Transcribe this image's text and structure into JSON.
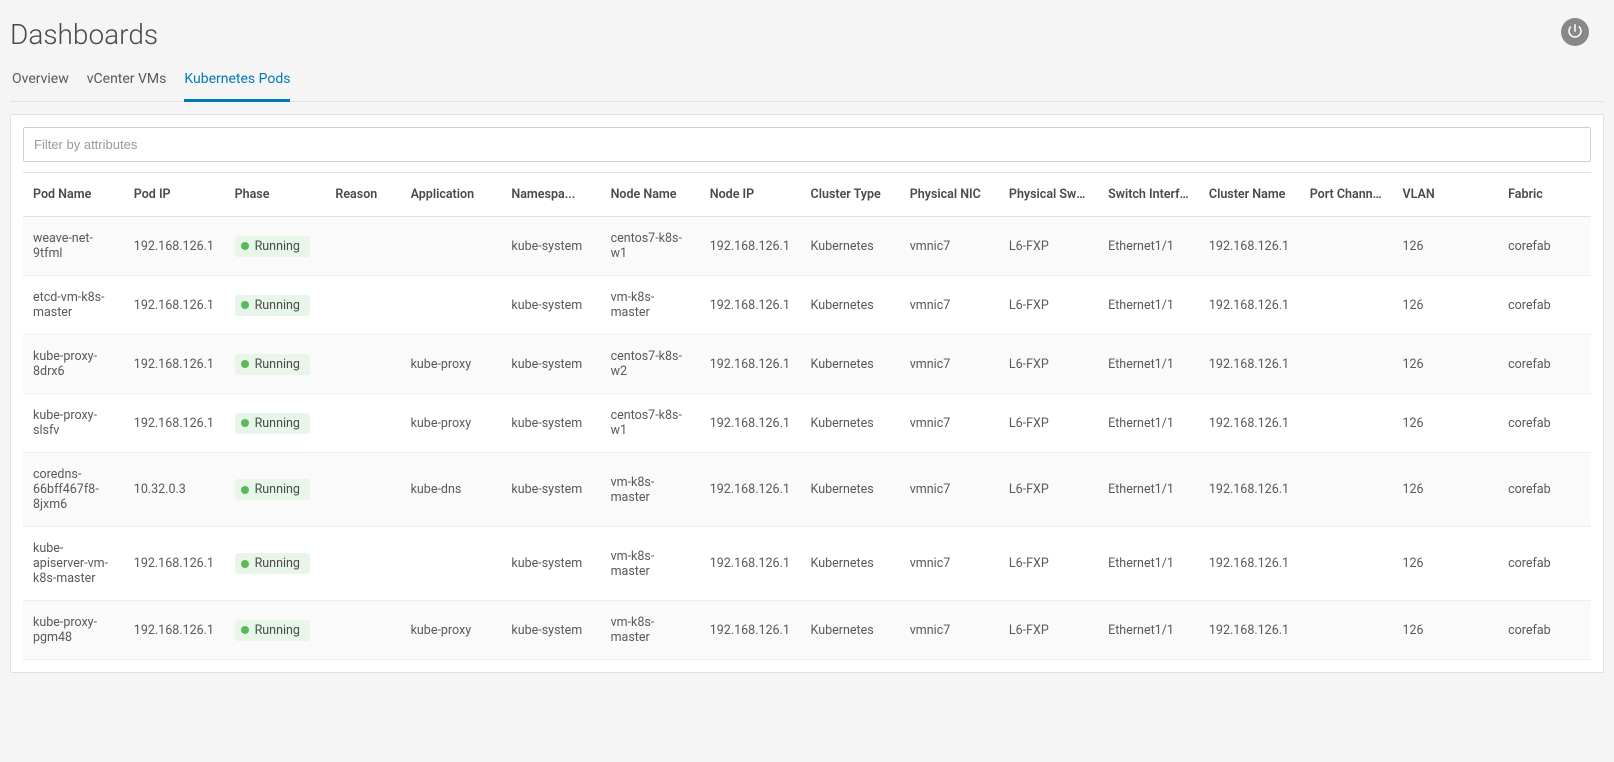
{
  "page_title": "Dashboards",
  "tabs": [
    {
      "label": "Overview",
      "active": false
    },
    {
      "label": "vCenter VMs",
      "active": false
    },
    {
      "label": "Kubernetes Pods",
      "active": true
    }
  ],
  "filter_placeholder": "Filter by attributes",
  "columns": [
    "Pod Name",
    "Pod IP",
    "Phase",
    "Reason",
    "Application",
    "Namespa...",
    "Node Name",
    "Node IP",
    "Cluster Type",
    "Physical NIC",
    "Physical Switch",
    "Switch Interface",
    "Cluster Name",
    "Port Channel",
    "VLAN",
    "Fabric"
  ],
  "rows": [
    {
      "pod_name": "weave-net-9tfml",
      "pod_ip": "192.168.126.1",
      "phase": "Running",
      "reason": "",
      "application": "",
      "namespace": "kube-system",
      "node_name": "centos7-k8s-w1",
      "node_ip": "192.168.126.1",
      "cluster_type": "Kubernetes",
      "physical_nic": "vmnic7",
      "physical_switch": "L6-FXP",
      "switch_interface": "Ethernet1/1",
      "cluster_name": "192.168.126.1",
      "port_channel": "",
      "vlan": "126",
      "fabric": "corefab"
    },
    {
      "pod_name": "etcd-vm-k8s-master",
      "pod_ip": "192.168.126.1",
      "phase": "Running",
      "reason": "",
      "application": "",
      "namespace": "kube-system",
      "node_name": "vm-k8s-master",
      "node_ip": "192.168.126.1",
      "cluster_type": "Kubernetes",
      "physical_nic": "vmnic7",
      "physical_switch": "L6-FXP",
      "switch_interface": "Ethernet1/1",
      "cluster_name": "192.168.126.1",
      "port_channel": "",
      "vlan": "126",
      "fabric": "corefab"
    },
    {
      "pod_name": "kube-proxy-8drx6",
      "pod_ip": "192.168.126.1",
      "phase": "Running",
      "reason": "",
      "application": "kube-proxy",
      "namespace": "kube-system",
      "node_name": "centos7-k8s-w2",
      "node_ip": "192.168.126.1",
      "cluster_type": "Kubernetes",
      "physical_nic": "vmnic7",
      "physical_switch": "L6-FXP",
      "switch_interface": "Ethernet1/1",
      "cluster_name": "192.168.126.1",
      "port_channel": "",
      "vlan": "126",
      "fabric": "corefab"
    },
    {
      "pod_name": "kube-proxy-slsfv",
      "pod_ip": "192.168.126.1",
      "phase": "Running",
      "reason": "",
      "application": "kube-proxy",
      "namespace": "kube-system",
      "node_name": "centos7-k8s-w1",
      "node_ip": "192.168.126.1",
      "cluster_type": "Kubernetes",
      "physical_nic": "vmnic7",
      "physical_switch": "L6-FXP",
      "switch_interface": "Ethernet1/1",
      "cluster_name": "192.168.126.1",
      "port_channel": "",
      "vlan": "126",
      "fabric": "corefab"
    },
    {
      "pod_name": "coredns-66bff467f8-8jxm6",
      "pod_ip": "10.32.0.3",
      "phase": "Running",
      "reason": "",
      "application": "kube-dns",
      "namespace": "kube-system",
      "node_name": "vm-k8s-master",
      "node_ip": "192.168.126.1",
      "cluster_type": "Kubernetes",
      "physical_nic": "vmnic7",
      "physical_switch": "L6-FXP",
      "switch_interface": "Ethernet1/1",
      "cluster_name": "192.168.126.1",
      "port_channel": "",
      "vlan": "126",
      "fabric": "corefab"
    },
    {
      "pod_name": "kube-apiserver-vm-k8s-master",
      "pod_ip": "192.168.126.1",
      "phase": "Running",
      "reason": "",
      "application": "",
      "namespace": "kube-system",
      "node_name": "vm-k8s-master",
      "node_ip": "192.168.126.1",
      "cluster_type": "Kubernetes",
      "physical_nic": "vmnic7",
      "physical_switch": "L6-FXP",
      "switch_interface": "Ethernet1/1",
      "cluster_name": "192.168.126.1",
      "port_channel": "",
      "vlan": "126",
      "fabric": "corefab"
    },
    {
      "pod_name": "kube-proxy-pgm48",
      "pod_ip": "192.168.126.1",
      "phase": "Running",
      "reason": "",
      "application": "kube-proxy",
      "namespace": "kube-system",
      "node_name": "vm-k8s-master",
      "node_ip": "192.168.126.1",
      "cluster_type": "Kubernetes",
      "physical_nic": "vmnic7",
      "physical_switch": "L6-FXP",
      "switch_interface": "Ethernet1/1",
      "cluster_name": "192.168.126.1",
      "port_channel": "",
      "vlan": "126",
      "fabric": "corefab"
    }
  ]
}
